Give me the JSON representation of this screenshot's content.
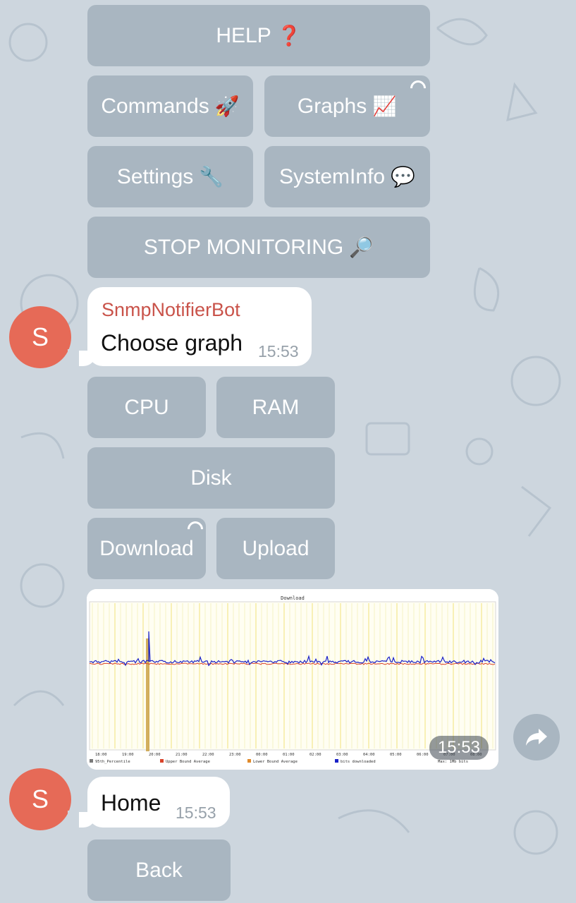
{
  "keyboard_top": {
    "help": {
      "label": "HELP",
      "emoji": "❓"
    },
    "commands": {
      "label": "Commands",
      "emoji": "🚀"
    },
    "graphs": {
      "label": "Graphs",
      "emoji": "📈"
    },
    "settings": {
      "label": "Settings",
      "emoji": "🔧"
    },
    "systeminfo": {
      "label": "SystemInfo",
      "emoji": "💬"
    },
    "stop": {
      "label": "STOP MONITORING",
      "emoji": "🔎"
    }
  },
  "message1": {
    "avatar_letter": "S",
    "sender": "SnmpNotifierBot",
    "text": "Choose graph",
    "time": "15:53"
  },
  "graph_keyboard": {
    "cpu": "CPU",
    "ram": "RAM",
    "disk": "Disk",
    "download": "Download",
    "upload": "Upload"
  },
  "photo": {
    "chart_title": "Download",
    "time": "15:53",
    "x_ticks": [
      "18:00",
      "19:00",
      "20:00",
      "21:00",
      "22:00",
      "23:00",
      "00:00",
      "01:00",
      "02:00",
      "03:00",
      "04:00",
      "05:00",
      "06:00",
      "07:00",
      "08:00"
    ],
    "legend": [
      "95th_Percentile",
      "Upper Bound Average",
      "Lower Bound Average",
      "bits downloaded",
      "Max: 1Mb bits"
    ],
    "colors": {
      "series": "#1a22c8",
      "upper": "#d9432a",
      "lower": "#e08a2a",
      "grid": "#f3ec9a",
      "spike": "#c89b3a"
    }
  },
  "message2": {
    "avatar_letter": "S",
    "text": "Home",
    "time": "15:53"
  },
  "bottom_keyboard": {
    "back": "Back"
  }
}
